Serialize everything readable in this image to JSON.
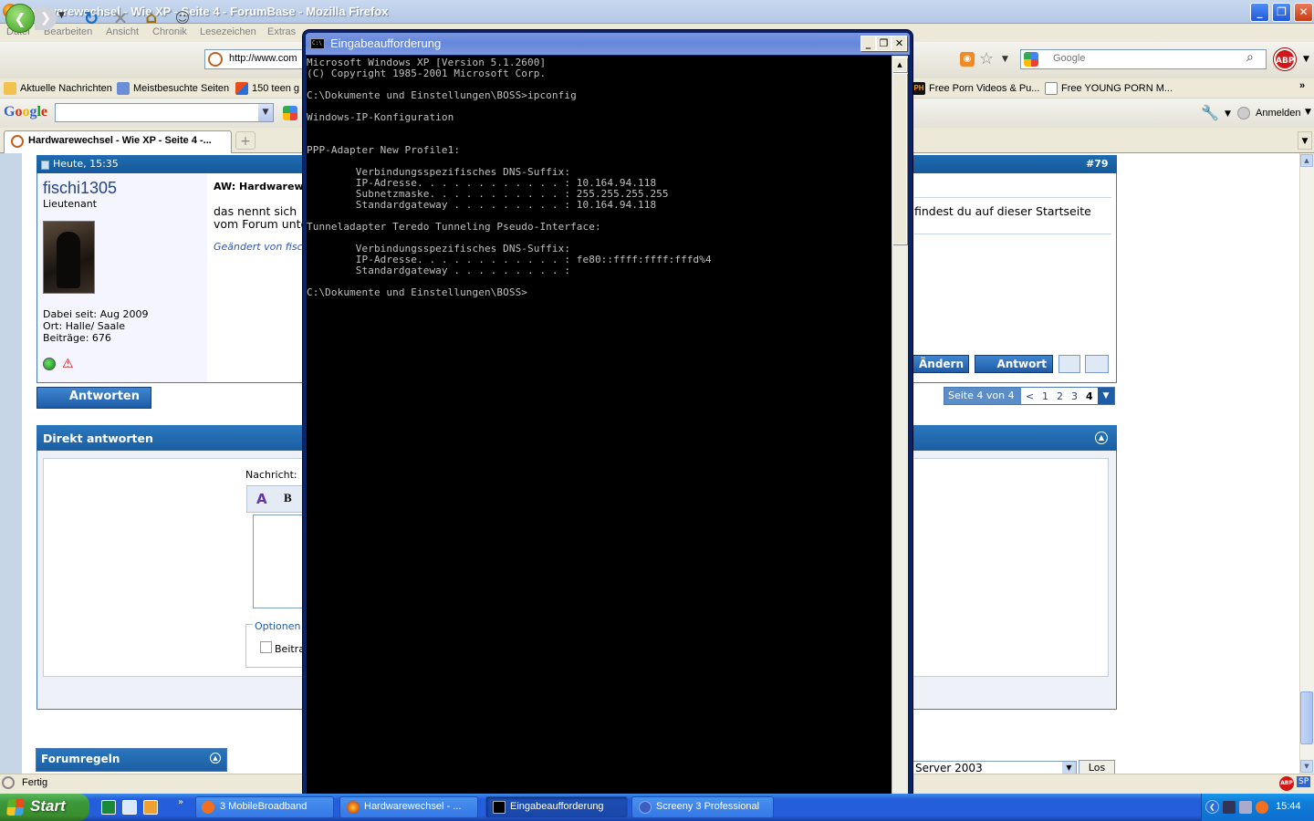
{
  "firefox": {
    "title": "Hardwarewechsel - Wie XP - Seite 4 - ForumBase - Mozilla Firefox",
    "menu": [
      "Datei",
      "Bearbeiten",
      "Ansicht",
      "Chronik",
      "Lesezeichen",
      "Extras"
    ],
    "url": "http://www.com",
    "search_placeholder": "Google",
    "bookmarks": {
      "left": [
        "Aktuelle Nachrichten",
        "Meistbesuchte Seiten",
        "150 teen g"
      ],
      "right": [
        "Free Porn Videos & Pu...",
        "Free YOUNG PORN M..."
      ],
      "more": "»"
    },
    "google_toolbar": {
      "logo": "Google",
      "signin": "Anmelden"
    },
    "tab": {
      "label": "Hardwarewechsel - Wie XP - Seite 4 -...",
      "new_tab": "+"
    },
    "status": "Fertig"
  },
  "post": {
    "date": "Heute, 15:35",
    "number": "#79",
    "username": "fischi1305",
    "rank": "Lieutenant",
    "joined": "Dabei seit: Aug 2009",
    "location": "Ort: Halle/ Saale",
    "posts": "Beiträge: 676",
    "title": "AW: Hardwarew",
    "text_line1": "das nennt sich",
    "text_line2": "vom Forum unte",
    "edited": "Geändert von fisc",
    "right_text": "findest du auf dieser Startseite",
    "btn_edit": "Ändern",
    "btn_reply": "Antwort"
  },
  "reply_button": "Antworten",
  "pager": {
    "label": "Seite 4 von 4",
    "prev": "<",
    "pages": [
      "1",
      "2",
      "3",
      "4"
    ],
    "current": "4"
  },
  "quick_reply": {
    "title": "Direkt antworten",
    "message_label": "Nachricht:",
    "bold": "B",
    "options_label": "Optionen",
    "checkbox_label": "Beitra"
  },
  "forum_rules": {
    "title": "Forumregeln"
  },
  "forum_jump": {
    "value": "Server 2003",
    "go": "Los"
  },
  "cmd": {
    "title": "Eingabeaufforderung",
    "icon_text": "C:\\",
    "output": "Microsoft Windows XP [Version 5.1.2600]\n(C) Copyright 1985-2001 Microsoft Corp.\n\nC:\\Dokumente und Einstellungen\\BOSS>ipconfig\n\nWindows-IP-Konfiguration\n\n\nPPP-Adapter New Profile1:\n\n        Verbindungsspezifisches DNS-Suffix:\n        IP-Adresse. . . . . . . . . . . . : 10.164.94.118\n        Subnetzmaske. . . . . . . . . . . : 255.255.255.255\n        Standardgateway . . . . . . . . . : 10.164.94.118\n\nTunneladapter Teredo Tunneling Pseudo-Interface:\n\n        Verbindungsspezifisches DNS-Suffix:\n        IP-Adresse. . . . . . . . . . . . : fe80::ffff:ffff:fffd%4\n        Standardgateway . . . . . . . . . :\n\nC:\\Dokumente und Einstellungen\\BOSS>"
  },
  "taskbar": {
    "start": "Start",
    "tasks": [
      {
        "label": "3 MobileBroadband",
        "active": false
      },
      {
        "label": "Hardwarewechsel - ...",
        "active": false
      },
      {
        "label": "Eingabeaufforderung",
        "active": true
      },
      {
        "label": "Screeny 3 Professional",
        "active": false
      }
    ],
    "clock": "15:44"
  },
  "colors": {
    "xp_blue": "#245edb",
    "forum_blue": "#1f5ca8",
    "cmd_text": "#c0c0c0",
    "start_green": "#3c9a3c"
  }
}
